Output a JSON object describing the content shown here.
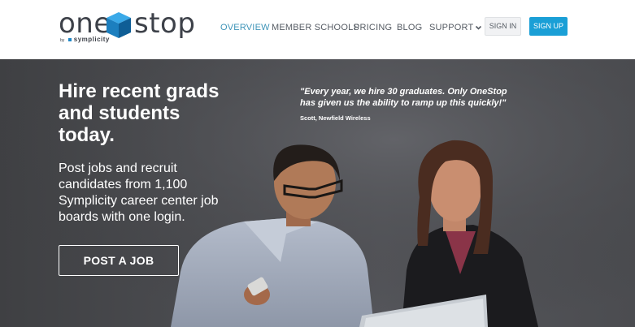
{
  "logo": {
    "word1": "one",
    "word2": "stop",
    "by": "by",
    "brand": "symplicity"
  },
  "nav": {
    "items": [
      {
        "label": "OVERVIEW",
        "active": true
      },
      {
        "label": "MEMBER SCHOOLS",
        "active": false
      },
      {
        "label": "PRICING",
        "active": false
      },
      {
        "label": "BLOG",
        "active": false
      },
      {
        "label": "SUPPORT",
        "active": false
      }
    ],
    "sign_in": "SIGN IN",
    "sign_up": "SIGN UP"
  },
  "hero": {
    "headline": "Hire recent grads and students today.",
    "subhead": "Post jobs and recruit candidates from 1,100 Symplicity career center job boards with one login.",
    "cta": "POST A JOB",
    "quote": "\"Every year, we hire 30 graduates. Only OneStop has given us the ability to ramp up this quickly!\"",
    "quote_by": "Scott, Newfield Wireless"
  },
  "colors": {
    "accent": "#1a9fd6",
    "nav_active": "#3e94b8",
    "text_dark": "#3d4149",
    "cube": "#1e86c6"
  },
  "icons": [
    "logo-cube-icon",
    "chevron-down-icon"
  ]
}
